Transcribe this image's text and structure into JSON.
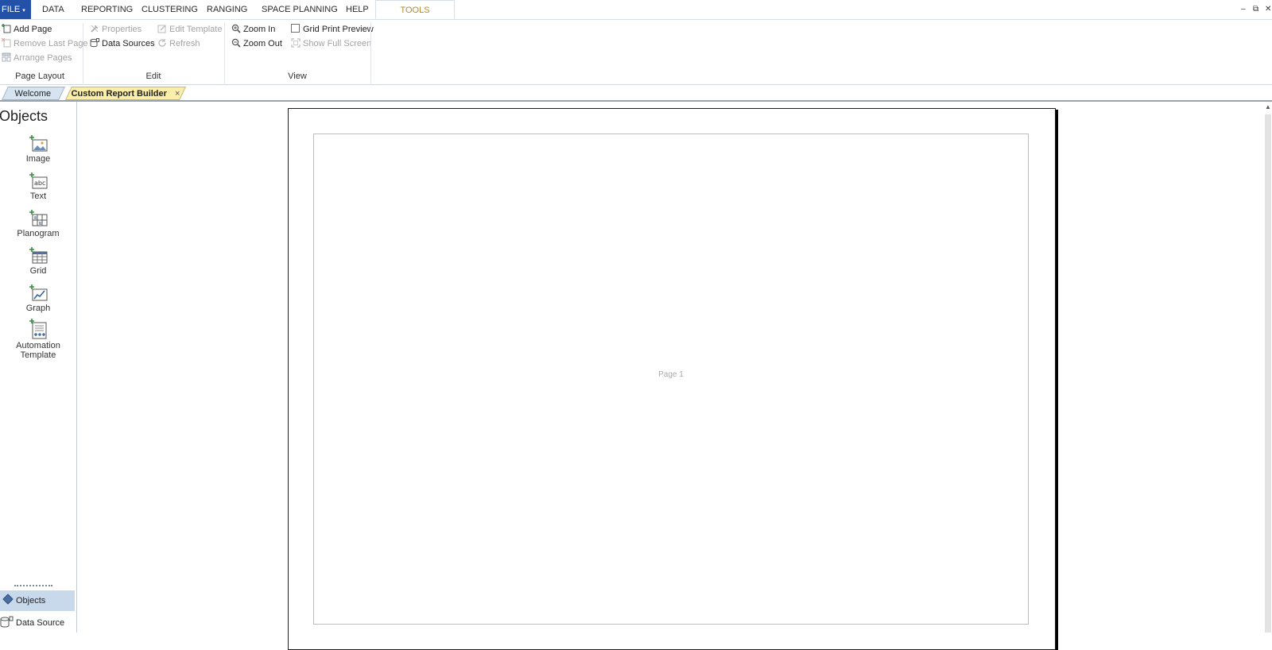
{
  "menu": {
    "file": "FILE",
    "tabs": [
      "DATA",
      "REPORTING",
      "CLUSTERING",
      "RANGING",
      "SPACE PLANNING",
      "HELP"
    ],
    "active_tab": "TOOLS",
    "window_controls": [
      "–",
      "⧉",
      "✕"
    ]
  },
  "ribbon": {
    "page_layout": {
      "label": "Page Layout",
      "add_page": "Add Page",
      "remove_last_page": "Remove Last Page",
      "arrange_pages": "Arrange Pages"
    },
    "edit": {
      "label": "Edit",
      "properties": "Properties",
      "data_sources": "Data Sources",
      "edit_template": "Edit Template",
      "refresh": "Refresh"
    },
    "view": {
      "label": "View",
      "zoom_in": "Zoom In",
      "zoom_out": "Zoom Out",
      "grid_print_preview": "Grid Print Preview",
      "grid_print_preview_checked": false,
      "show_full_screen": "Show Full Screen"
    }
  },
  "doc_tabs": {
    "welcome": "Welcome",
    "custom_report_builder": "Custom Report Builder",
    "close_glyph": "×"
  },
  "objects_panel": {
    "title": "Objects",
    "items": {
      "image": "Image",
      "text": "Text",
      "planogram": "Planogram",
      "grid": "Grid",
      "graph": "Graph",
      "automation_line1": "Automation",
      "automation_line2": "Template"
    },
    "nav": {
      "objects": "Objects",
      "data_source": "Data Source"
    }
  },
  "canvas": {
    "page_label": "Page 1"
  },
  "colors": {
    "file_tab": "#2451a8",
    "tools_tab_text": "#b58a28",
    "active_doc_tab": "#fbeeab",
    "panel_selected": "#c9d9ec"
  }
}
